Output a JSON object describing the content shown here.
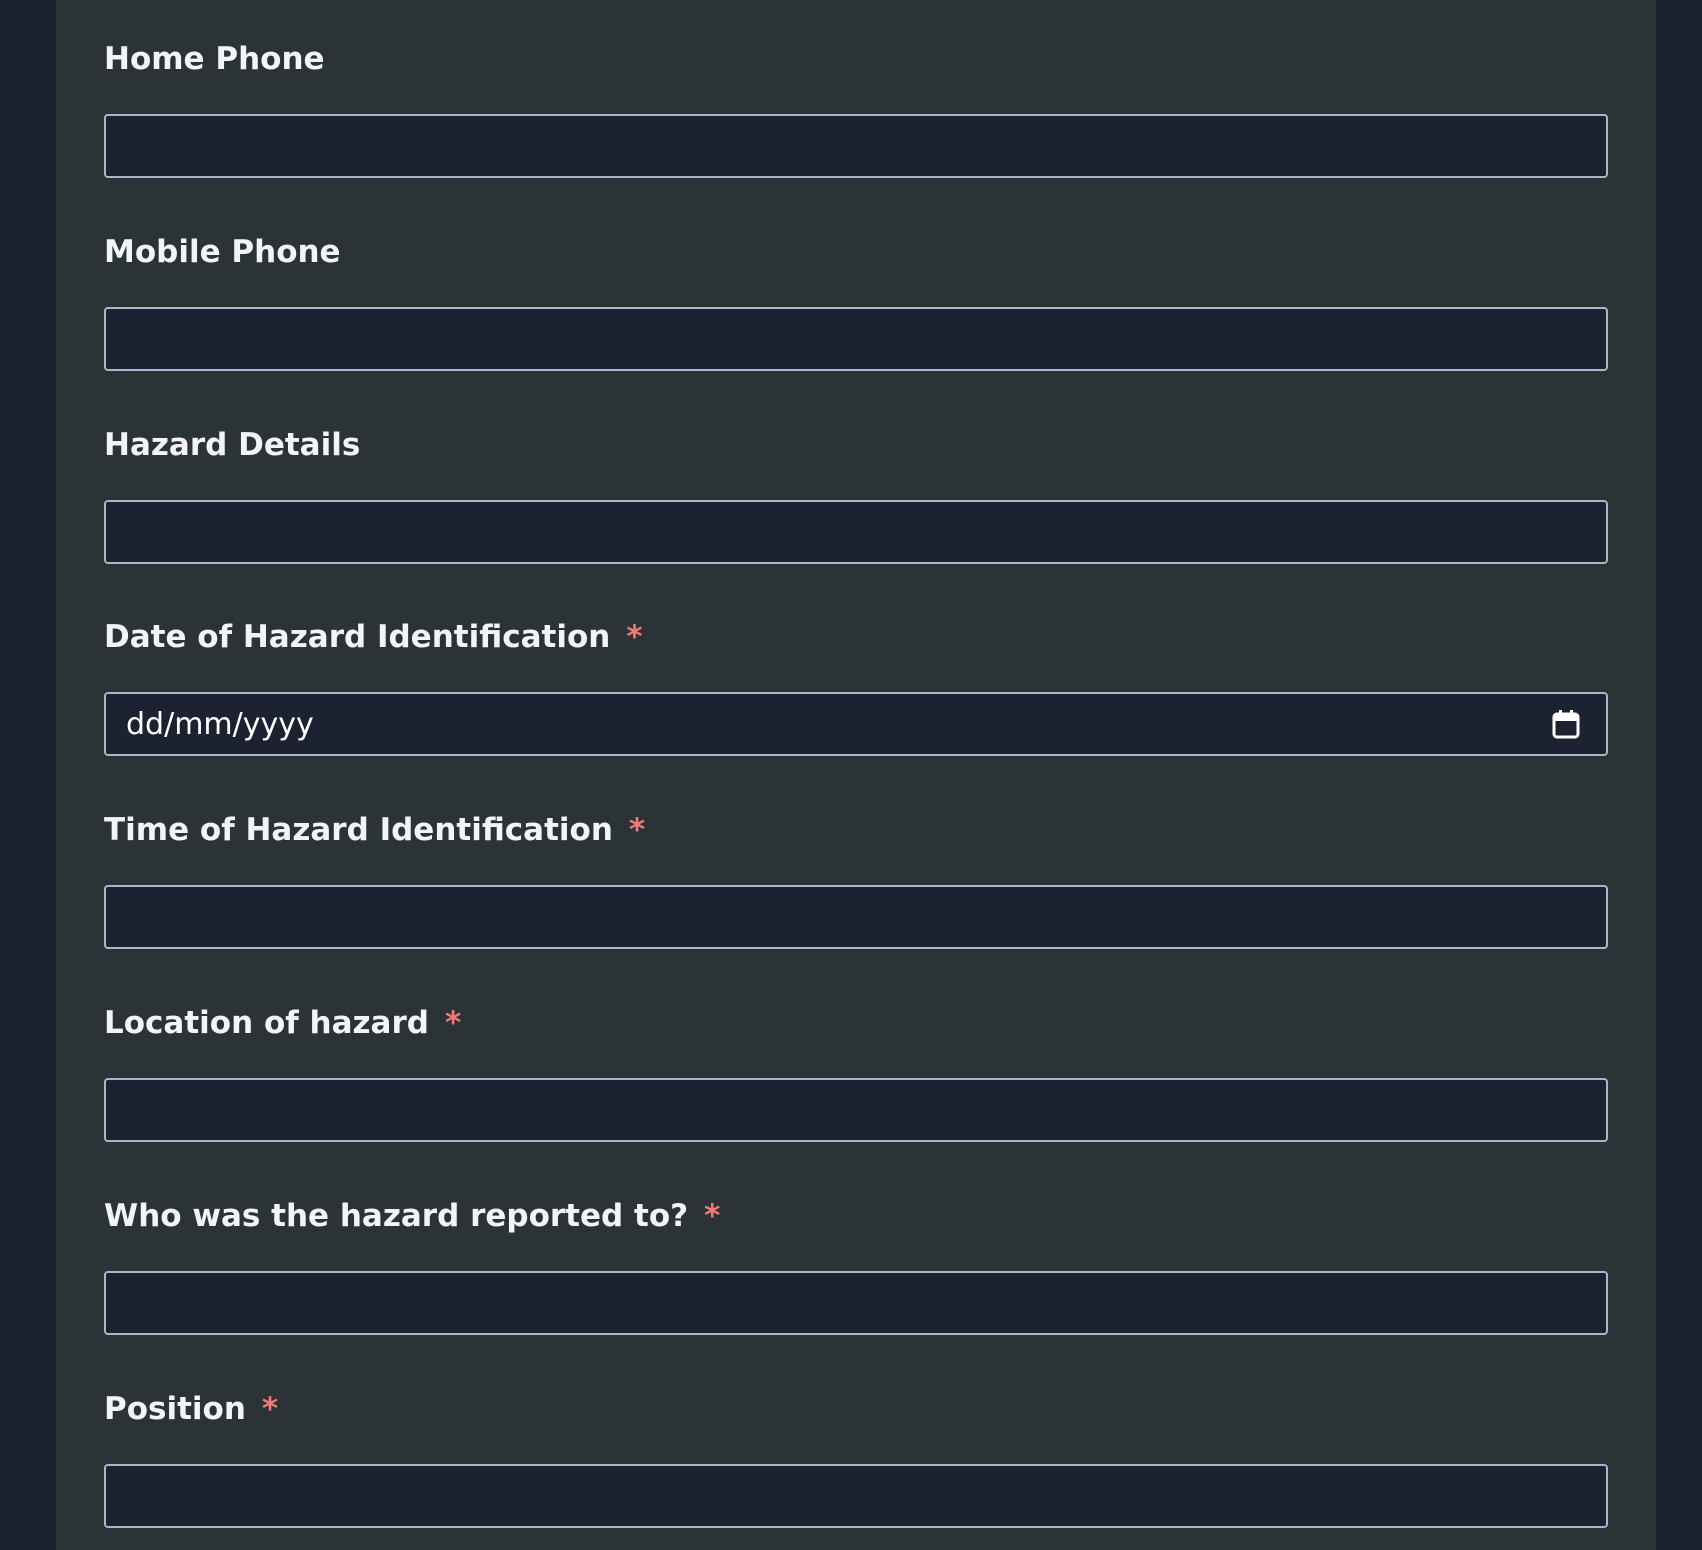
{
  "form": {
    "fields": [
      {
        "label": "Home Phone",
        "required": false,
        "value": "",
        "placeholder": ""
      },
      {
        "label": "Mobile Phone",
        "required": false,
        "value": "",
        "placeholder": ""
      },
      {
        "label": "Hazard Details",
        "required": false,
        "value": "",
        "placeholder": ""
      },
      {
        "label": "Date of Hazard Identification",
        "required": true,
        "value": "",
        "placeholder": "dd/mm/yyyy",
        "icon": "calendar-icon"
      },
      {
        "label": "Time of Hazard Identification",
        "required": true,
        "value": "",
        "placeholder": ""
      },
      {
        "label": "Location of hazard",
        "required": true,
        "value": "",
        "placeholder": ""
      },
      {
        "label": "Who was the hazard reported to?",
        "required": true,
        "value": "",
        "placeholder": ""
      },
      {
        "label": "Position",
        "required": true,
        "value": "",
        "placeholder": ""
      }
    ],
    "required_marker": "*"
  },
  "colors": {
    "page_background": "#1d2233",
    "panel_background": "#2c3337",
    "input_background": "#1d2233",
    "input_border": "#aeb5c4",
    "label_text": "#f3f4f6",
    "required_marker": "#f07a74"
  }
}
